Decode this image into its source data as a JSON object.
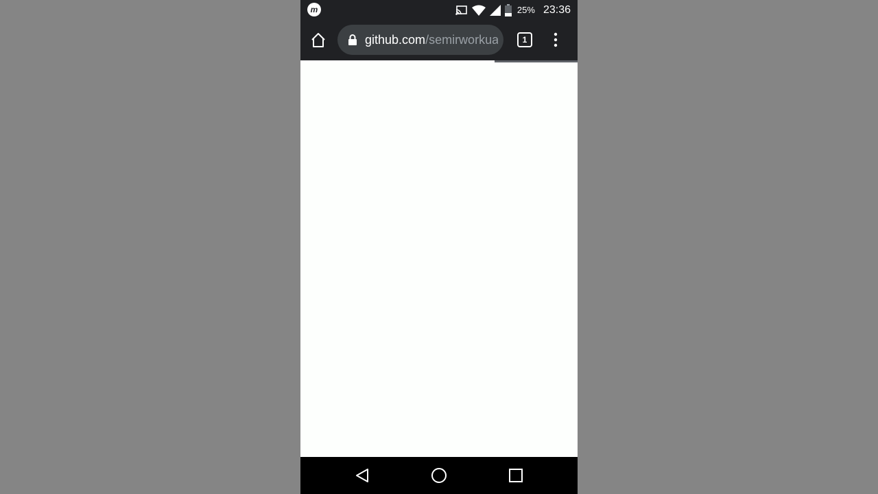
{
  "status_bar": {
    "app_icon_letter": "m",
    "battery_percent": "25%",
    "time": "23:36",
    "icons": [
      "cast-icon",
      "wifi-icon",
      "cell-signal-icon",
      "battery-icon"
    ]
  },
  "toolbar": {
    "url_host": "github.com",
    "url_path": "/semirworkua",
    "tab_count": "1",
    "icons": [
      "home-icon",
      "lock-icon",
      "tab-switcher-icon",
      "overflow-menu-icon"
    ]
  },
  "page_load_progress": 0.7,
  "nav_bar": {
    "icons": [
      "back-icon",
      "home-circle-icon",
      "recents-icon"
    ]
  },
  "colors": {
    "chrome_bg": "#202124",
    "omnibox_bg": "#3c4043",
    "page_bg": "#fdfffd",
    "outer_bg": "#858585"
  }
}
